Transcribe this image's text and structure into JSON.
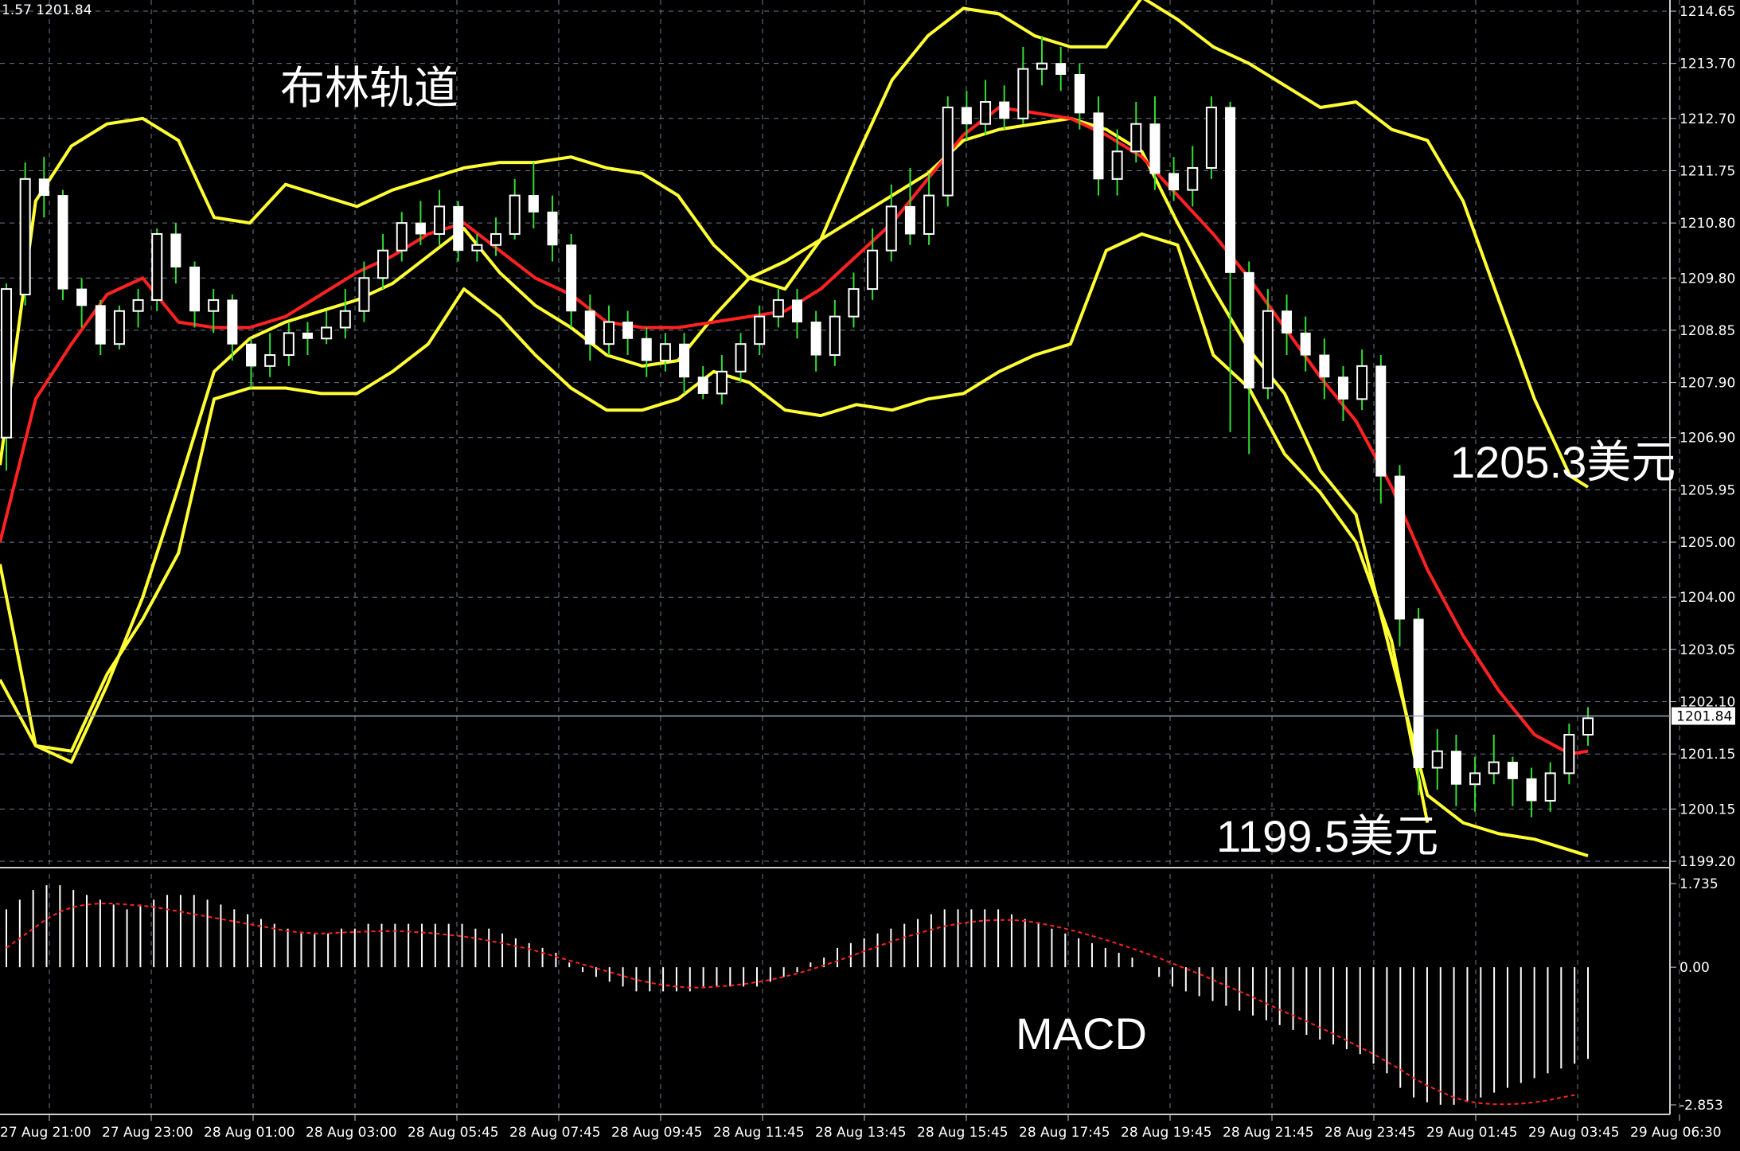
{
  "window": {
    "header_text": "1.57 1201.84"
  },
  "chart_data": {
    "type": "line",
    "price_axis": {
      "ticks": [
        "1214.65",
        "1213.70",
        "1212.70",
        "1211.75",
        "1210.80",
        "1209.80",
        "1208.85",
        "1207.90",
        "1206.90",
        "1205.95",
        "1205.00",
        "1204.00",
        "1203.05",
        "1202.10",
        "1201.15",
        "1200.15",
        "1199.20"
      ],
      "ylim": [
        1199.2,
        1214.65
      ],
      "current_price": "1201.84",
      "current_price_value": 1201.84
    },
    "time_axis": {
      "labels": [
        "27 Aug 21:00",
        "27 Aug 23:00",
        "28 Aug 01:00",
        "28 Aug 03:00",
        "28 Aug 05:45",
        "28 Aug 07:45",
        "28 Aug 09:45",
        "28 Aug 11:45",
        "28 Aug 13:45",
        "28 Aug 15:45",
        "28 Aug 17:45",
        "28 Aug 19:45",
        "28 Aug 21:45",
        "28 Aug 23:45",
        "29 Aug 01:45",
        "29 Aug 03:45",
        "29 Aug 06:30"
      ]
    },
    "bollinger": {
      "upper_color": "#ffff33",
      "middle_color": "#ff2222",
      "lower_color": "#ffff33",
      "x": [
        0,
        4,
        8,
        12,
        16,
        20,
        24,
        28,
        32,
        36,
        40,
        44,
        48,
        52,
        56,
        60,
        64,
        68,
        72,
        76,
        80,
        84,
        88,
        92,
        96,
        100,
        104,
        108,
        112,
        116,
        120,
        124,
        128,
        132,
        136,
        140,
        144,
        148,
        152,
        156,
        160,
        164,
        168,
        172,
        176,
        178
      ],
      "upper": [
        1206.4,
        1211.2,
        1212.2,
        1212.6,
        1212.7,
        1212.3,
        1210.9,
        1210.8,
        1211.5,
        1211.3,
        1211.1,
        1211.4,
        1211.6,
        1211.8,
        1211.9,
        1211.9,
        1212.0,
        1211.8,
        1211.7,
        1211.3,
        1210.4,
        1209.8,
        1209.6,
        1210.5,
        1212.0,
        1213.4,
        1214.2,
        1214.7,
        1214.6,
        1214.2,
        1214.0,
        1214.0,
        1214.9,
        1214.5,
        1214.0,
        1213.7,
        1213.3,
        1212.9,
        1213.0,
        1212.5,
        1212.3,
        1211.2,
        1209.4,
        1207.6,
        1206.2,
        1206.0
      ],
      "middle": [
        1205.0,
        1207.6,
        1208.6,
        1209.5,
        1209.8,
        1209.0,
        1208.9,
        1208.9,
        1209.1,
        1209.5,
        1209.9,
        1210.2,
        1210.6,
        1210.8,
        1210.3,
        1209.8,
        1209.5,
        1209.0,
        1208.9,
        1208.9,
        1209.0,
        1209.1,
        1209.2,
        1209.6,
        1210.2,
        1210.8,
        1211.6,
        1212.4,
        1212.9,
        1212.8,
        1212.7,
        1212.4,
        1212.0,
        1211.3,
        1210.6,
        1209.8,
        1208.9,
        1208.0,
        1207.2,
        1206.0,
        1204.5,
        1203.3,
        1202.3,
        1201.5,
        1201.15,
        1201.2
      ],
      "lower": [
        1204.6,
        1201.3,
        1201.0,
        1202.4,
        1204.0,
        1206.0,
        1208.1,
        1208.7,
        1209.0,
        1209.2,
        1209.4,
        1209.7,
        1210.2,
        1210.7,
        1209.9,
        1209.3,
        1208.9,
        1208.4,
        1208.2,
        1208.3,
        1209.1,
        1209.8,
        1210.1,
        1210.5,
        1210.9,
        1211.3,
        1211.7,
        1212.3,
        1212.5,
        1212.6,
        1212.7,
        1212.5,
        1212.1,
        1210.8,
        1209.6,
        1208.5,
        1207.7,
        1206.3,
        1205.5,
        1202.9,
        1200.4,
        1199.9,
        1199.7,
        1199.6,
        1199.4,
        1199.3
      ]
    },
    "bands_lower_outer": {
      "x": [
        0,
        4,
        8,
        12,
        16,
        20,
        24,
        28,
        32,
        36,
        40,
        44,
        48,
        52,
        56,
        60,
        64,
        68,
        72,
        76,
        80,
        84,
        88,
        92,
        96,
        100,
        104,
        108,
        112,
        116,
        120,
        124,
        128,
        132,
        136,
        140,
        144,
        148,
        152,
        156,
        160
      ],
      "values": [
        1202.5,
        1201.3,
        1201.2,
        1202.6,
        1203.6,
        1204.8,
        1207.6,
        1207.8,
        1207.8,
        1207.7,
        1207.7,
        1208.1,
        1208.6,
        1209.6,
        1209.1,
        1208.4,
        1207.8,
        1207.4,
        1207.4,
        1207.6,
        1208.1,
        1207.9,
        1207.4,
        1207.3,
        1207.5,
        1207.4,
        1207.6,
        1207.7,
        1208.1,
        1208.4,
        1208.6,
        1210.3,
        1210.6,
        1210.4,
        1208.4,
        1207.8,
        1206.6,
        1205.9,
        1205.0,
        1203.2,
        1199.9
      ]
    },
    "candles": {
      "bull_color": "#ffffff",
      "bear_color": "#ffffff",
      "wick_color": "#33dd33",
      "data": [
        [
          0,
          1206.9,
          1209.6,
          1206.3,
          1209.7
        ],
        [
          1,
          1209.5,
          1211.6,
          1209.3,
          1211.9
        ],
        [
          2,
          1211.6,
          1211.3,
          1210.9,
          1212.0
        ],
        [
          3,
          1211.3,
          1209.6,
          1209.4,
          1211.4
        ],
        [
          4,
          1209.6,
          1209.3,
          1208.9,
          1209.8
        ],
        [
          5,
          1209.3,
          1208.6,
          1208.4,
          1209.4
        ],
        [
          6,
          1208.6,
          1209.2,
          1208.5,
          1209.3
        ],
        [
          7,
          1209.2,
          1209.4,
          1208.9,
          1209.6
        ],
        [
          8,
          1209.4,
          1210.6,
          1209.2,
          1210.7
        ],
        [
          9,
          1210.6,
          1210.0,
          1209.7,
          1210.8
        ],
        [
          10,
          1210.0,
          1209.2,
          1208.9,
          1210.1
        ],
        [
          11,
          1209.2,
          1209.4,
          1208.8,
          1209.6
        ],
        [
          12,
          1209.4,
          1208.6,
          1208.3,
          1209.5
        ],
        [
          13,
          1208.6,
          1208.2,
          1207.8,
          1208.7
        ],
        [
          14,
          1208.2,
          1208.4,
          1208.0,
          1208.8
        ],
        [
          15,
          1208.4,
          1208.8,
          1208.2,
          1209.0
        ],
        [
          16,
          1208.8,
          1208.7,
          1208.4,
          1209.0
        ],
        [
          17,
          1208.7,
          1208.9,
          1208.6,
          1209.2
        ],
        [
          18,
          1208.9,
          1209.2,
          1208.7,
          1209.6
        ],
        [
          19,
          1209.2,
          1209.8,
          1209.0,
          1210.1
        ],
        [
          20,
          1209.8,
          1210.3,
          1209.6,
          1210.6
        ],
        [
          21,
          1210.3,
          1210.8,
          1210.1,
          1211.0
        ],
        [
          22,
          1210.8,
          1210.6,
          1210.4,
          1211.2
        ],
        [
          23,
          1210.6,
          1211.1,
          1210.4,
          1211.4
        ],
        [
          24,
          1211.1,
          1210.3,
          1210.1,
          1211.2
        ],
        [
          25,
          1210.3,
          1210.4,
          1210.1,
          1210.6
        ],
        [
          26,
          1210.4,
          1210.6,
          1210.2,
          1210.9
        ],
        [
          27,
          1210.6,
          1211.3,
          1210.5,
          1211.6
        ],
        [
          28,
          1211.3,
          1211.0,
          1210.7,
          1211.9
        ],
        [
          29,
          1211.0,
          1210.4,
          1210.1,
          1211.3
        ],
        [
          30,
          1210.4,
          1209.2,
          1208.9,
          1210.6
        ],
        [
          31,
          1209.2,
          1208.6,
          1208.3,
          1209.5
        ],
        [
          32,
          1208.6,
          1209.0,
          1208.4,
          1209.3
        ],
        [
          33,
          1209.0,
          1208.7,
          1208.4,
          1209.2
        ],
        [
          34,
          1208.7,
          1208.3,
          1208.0,
          1208.9
        ],
        [
          35,
          1208.3,
          1208.6,
          1208.1,
          1208.8
        ],
        [
          36,
          1208.6,
          1208.0,
          1207.7,
          1208.8
        ],
        [
          37,
          1208.0,
          1207.7,
          1207.6,
          1208.2
        ],
        [
          38,
          1207.7,
          1208.1,
          1207.5,
          1208.4
        ],
        [
          39,
          1208.1,
          1208.6,
          1207.9,
          1208.8
        ],
        [
          40,
          1208.6,
          1209.1,
          1208.4,
          1209.3
        ],
        [
          41,
          1209.1,
          1209.4,
          1208.9,
          1209.6
        ],
        [
          42,
          1209.4,
          1209.0,
          1208.7,
          1209.6
        ],
        [
          43,
          1209.0,
          1208.4,
          1208.1,
          1209.2
        ],
        [
          44,
          1208.4,
          1209.1,
          1208.2,
          1209.4
        ],
        [
          45,
          1209.1,
          1209.6,
          1208.9,
          1209.9
        ],
        [
          46,
          1209.6,
          1210.3,
          1209.4,
          1210.7
        ],
        [
          47,
          1210.3,
          1211.1,
          1210.1,
          1211.5
        ],
        [
          48,
          1211.1,
          1210.6,
          1210.4,
          1211.8
        ],
        [
          49,
          1210.6,
          1211.3,
          1210.4,
          1211.7
        ],
        [
          50,
          1211.3,
          1212.9,
          1211.1,
          1213.1
        ],
        [
          51,
          1212.9,
          1212.6,
          1212.3,
          1213.2
        ],
        [
          52,
          1212.6,
          1213.0,
          1212.4,
          1213.4
        ],
        [
          53,
          1213.0,
          1212.7,
          1212.5,
          1213.3
        ],
        [
          54,
          1212.7,
          1213.6,
          1212.6,
          1214.0
        ],
        [
          55,
          1213.6,
          1213.7,
          1213.3,
          1214.2
        ],
        [
          56,
          1213.7,
          1213.5,
          1213.2,
          1214.0
        ],
        [
          57,
          1213.5,
          1212.8,
          1212.5,
          1213.7
        ],
        [
          58,
          1212.8,
          1211.6,
          1211.3,
          1213.1
        ],
        [
          59,
          1211.6,
          1212.1,
          1211.3,
          1212.5
        ],
        [
          60,
          1212.1,
          1212.6,
          1211.9,
          1213.0
        ],
        [
          61,
          1212.6,
          1211.7,
          1211.4,
          1213.1
        ],
        [
          62,
          1211.7,
          1211.4,
          1211.2,
          1212.0
        ],
        [
          63,
          1211.4,
          1211.8,
          1211.1,
          1212.2
        ],
        [
          64,
          1211.8,
          1212.9,
          1211.6,
          1213.1
        ],
        [
          65,
          1212.9,
          1209.9,
          1207.0,
          1213.0
        ],
        [
          66,
          1209.9,
          1207.8,
          1206.6,
          1210.1
        ],
        [
          67,
          1207.8,
          1209.2,
          1207.6,
          1209.6
        ],
        [
          68,
          1209.2,
          1208.8,
          1208.4,
          1209.5
        ],
        [
          69,
          1208.8,
          1208.4,
          1208.1,
          1209.1
        ],
        [
          70,
          1208.4,
          1208.0,
          1207.6,
          1208.7
        ],
        [
          71,
          1208.0,
          1207.6,
          1207.2,
          1208.2
        ],
        [
          72,
          1207.6,
          1208.2,
          1207.4,
          1208.5
        ],
        [
          73,
          1208.2,
          1206.2,
          1205.7,
          1208.4
        ],
        [
          74,
          1206.2,
          1203.6,
          1203.1,
          1206.4
        ],
        [
          75,
          1203.6,
          1200.9,
          1200.4,
          1203.8
        ],
        [
          76,
          1200.9,
          1201.2,
          1200.5,
          1201.6
        ],
        [
          77,
          1201.2,
          1200.6,
          1200.2,
          1201.5
        ],
        [
          78,
          1200.6,
          1200.8,
          1200.1,
          1201.1
        ],
        [
          79,
          1200.8,
          1201.0,
          1200.6,
          1201.5
        ],
        [
          80,
          1201.0,
          1200.7,
          1200.2,
          1201.1
        ],
        [
          81,
          1200.7,
          1200.3,
          1200.0,
          1200.9
        ],
        [
          82,
          1200.3,
          1200.8,
          1200.1,
          1201.0
        ],
        [
          83,
          1200.8,
          1201.5,
          1200.6,
          1201.7
        ],
        [
          84,
          1201.5,
          1201.8,
          1201.3,
          1202.0
        ]
      ]
    },
    "macd": {
      "axis_ticks": [
        "1.735",
        "0.00",
        "-2.853"
      ],
      "ylim": [
        -2.853,
        1.735
      ],
      "histogram_color": "#ffffff",
      "signal_color": "#ff2222",
      "histogram": [
        1.2,
        1.4,
        1.6,
        1.7,
        1.7,
        1.6,
        1.5,
        1.4,
        1.3,
        1.2,
        1.3,
        1.4,
        1.5,
        1.5,
        1.5,
        1.4,
        1.3,
        1.2,
        1.1,
        1.0,
        0.9,
        0.8,
        0.7,
        0.7,
        0.7,
        0.8,
        0.8,
        0.9,
        0.9,
        0.9,
        0.9,
        0.9,
        0.9,
        0.9,
        0.9,
        0.8,
        0.8,
        0.7,
        0.6,
        0.5,
        0.4,
        0.3,
        0.1,
        -0.1,
        -0.2,
        -0.3,
        -0.4,
        -0.5,
        -0.5,
        -0.5,
        -0.5,
        -0.5,
        -0.4,
        -0.4,
        -0.4,
        -0.4,
        -0.4,
        -0.3,
        -0.2,
        -0.1,
        0.1,
        0.2,
        0.4,
        0.5,
        0.6,
        0.7,
        0.8,
        0.9,
        1.0,
        1.1,
        1.2,
        1.2,
        1.2,
        1.2,
        1.2,
        1.1,
        1.0,
        0.9,
        0.8,
        0.7,
        0.6,
        0.5,
        0.4,
        0.3,
        0.2,
        0.0,
        -0.2,
        -0.4,
        -0.5,
        -0.6,
        -0.7,
        -0.8,
        -0.9,
        -1.0,
        -1.1,
        -1.2,
        -1.3,
        -1.4,
        -1.5,
        -1.6,
        -1.7,
        -1.8,
        -2.0,
        -2.2,
        -2.5,
        -2.7,
        -2.8,
        -2.85,
        -2.85,
        -2.8,
        -2.7,
        -2.6,
        -2.5,
        -2.4,
        -2.3,
        -2.2,
        -2.1,
        -2.0,
        -1.9
      ],
      "signal": [
        0.4,
        0.6,
        0.8,
        1.0,
        1.15,
        1.25,
        1.3,
        1.32,
        1.32,
        1.3,
        1.28,
        1.25,
        1.2,
        1.15,
        1.1,
        1.05,
        1.0,
        0.95,
        0.9,
        0.85,
        0.8,
        0.75,
        0.72,
        0.7,
        0.7,
        0.72,
        0.73,
        0.74,
        0.75,
        0.75,
        0.74,
        0.72,
        0.7,
        0.67,
        0.64,
        0.6,
        0.55,
        0.5,
        0.44,
        0.38,
        0.3,
        0.22,
        0.14,
        0.06,
        -0.02,
        -0.1,
        -0.18,
        -0.26,
        -0.32,
        -0.37,
        -0.4,
        -0.42,
        -0.42,
        -0.4,
        -0.38,
        -0.35,
        -0.31,
        -0.26,
        -0.2,
        -0.13,
        -0.05,
        0.04,
        0.13,
        0.23,
        0.33,
        0.43,
        0.53,
        0.62,
        0.7,
        0.78,
        0.85,
        0.9,
        0.94,
        0.97,
        0.98,
        0.98,
        0.96,
        0.92,
        0.86,
        0.8,
        0.73,
        0.65,
        0.57,
        0.48,
        0.39,
        0.29,
        0.19,
        0.08,
        -0.03,
        -0.14,
        -0.26,
        -0.38,
        -0.5,
        -0.62,
        -0.75,
        -0.88,
        -1.0,
        -1.12,
        -1.25,
        -1.38,
        -1.52,
        -1.66,
        -1.8,
        -1.96,
        -2.12,
        -2.3,
        -2.45,
        -2.58,
        -2.7,
        -2.78,
        -2.82,
        -2.84,
        -2.84,
        -2.83,
        -2.8,
        -2.76,
        -2.7,
        -2.65
      ]
    }
  },
  "annotations": {
    "bollinger_label": "布林轨道",
    "upper_price_label": "1205.3美元",
    "lower_price_label": "1199.5美元",
    "macd_label": "MACD"
  }
}
